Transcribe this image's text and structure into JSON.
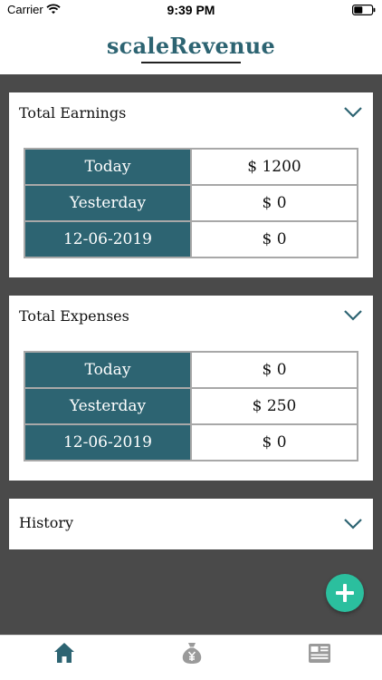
{
  "status_bar": {
    "carrier": "Carrier",
    "time": "9:39 PM"
  },
  "app": {
    "title": "scaleRevenue",
    "accent_color": "#2d6472",
    "fab_color": "#2bbf9e"
  },
  "earnings": {
    "title": "Total Earnings",
    "rows": [
      {
        "label": "Today",
        "value": "$ 1200"
      },
      {
        "label": "Yesterday",
        "value": "$ 0"
      },
      {
        "label": "12-06-2019",
        "value": "$ 0"
      }
    ]
  },
  "expenses": {
    "title": "Total Expenses",
    "rows": [
      {
        "label": "Today",
        "value": "$ 0"
      },
      {
        "label": "Yesterday",
        "value": "$ 250"
      },
      {
        "label": "12-06-2019",
        "value": "$ 0"
      }
    ]
  },
  "history": {
    "title": "History"
  },
  "icons": {
    "wifi": "wifi-icon",
    "battery": "battery-icon",
    "chevron": "chevron-down-icon",
    "fab": "plus-icon",
    "tab_home": "home-icon",
    "tab_money": "money-bag-icon",
    "tab_report": "report-icon"
  }
}
